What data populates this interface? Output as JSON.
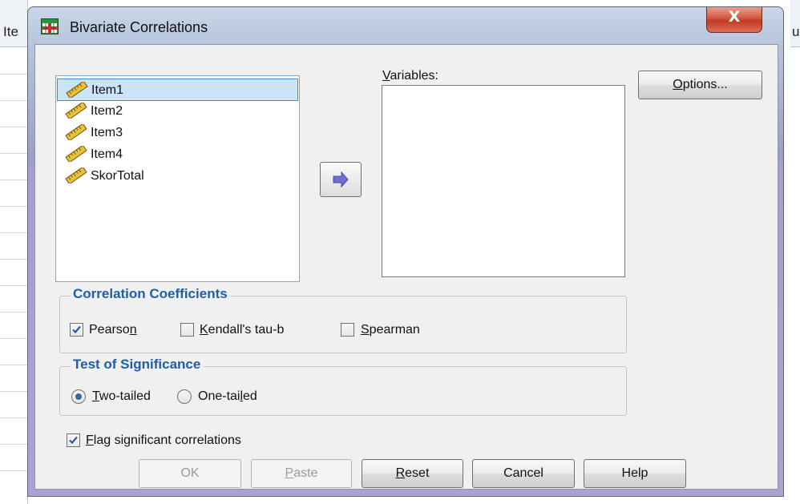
{
  "background": {
    "left_header_text": "Ite",
    "right_header_text": "ur"
  },
  "dialog": {
    "title": "Bivariate Correlations",
    "close_symbol": "X",
    "source_variables": [
      {
        "label": "Item1",
        "selected": true,
        "icon": "scale-ruler-icon"
      },
      {
        "label": "Item2",
        "selected": false,
        "icon": "scale-ruler-icon"
      },
      {
        "label": "Item3",
        "selected": false,
        "icon": "scale-ruler-icon"
      },
      {
        "label": "Item4",
        "selected": false,
        "icon": "scale-ruler-icon"
      },
      {
        "label": "SkorTotal",
        "selected": false,
        "icon": "scale-ruler-icon"
      }
    ],
    "variables_label": {
      "mnemonic": "V",
      "rest": "ariables:"
    },
    "options_button": {
      "mnemonic": "O",
      "rest": "ptions..."
    },
    "correlation_coefficients": {
      "title": "Correlation Coefficients",
      "pearson": {
        "pre": "Pearso",
        "mnemonic": "n",
        "post": "",
        "checked": true
      },
      "kendall": {
        "pre": "",
        "mnemonic": "K",
        "post": "endall's tau-b",
        "checked": false
      },
      "spearman": {
        "pre": "",
        "mnemonic": "S",
        "post": "pearman",
        "checked": false
      }
    },
    "test_of_significance": {
      "title": "Test of Significance",
      "two_tailed": {
        "pre": "",
        "mnemonic": "T",
        "post": "wo-tailed",
        "selected": true
      },
      "one_tailed": {
        "pre": "One-tai",
        "mnemonic": "l",
        "post": "ed",
        "selected": false
      }
    },
    "flag": {
      "pre": "",
      "mnemonic": "F",
      "post": "lag significant correlations",
      "checked": true
    },
    "buttons": {
      "ok": "OK",
      "paste": {
        "mnemonic": "P",
        "rest": "aste"
      },
      "reset": {
        "mnemonic": "R",
        "rest": "eset"
      },
      "cancel": "Cancel",
      "help": "Help"
    },
    "colors": {
      "group_title": "#1f5ea8",
      "selection_bg": "#cce4f7",
      "close_button": "#c23a22",
      "arrow": "#6f6fcf"
    }
  }
}
